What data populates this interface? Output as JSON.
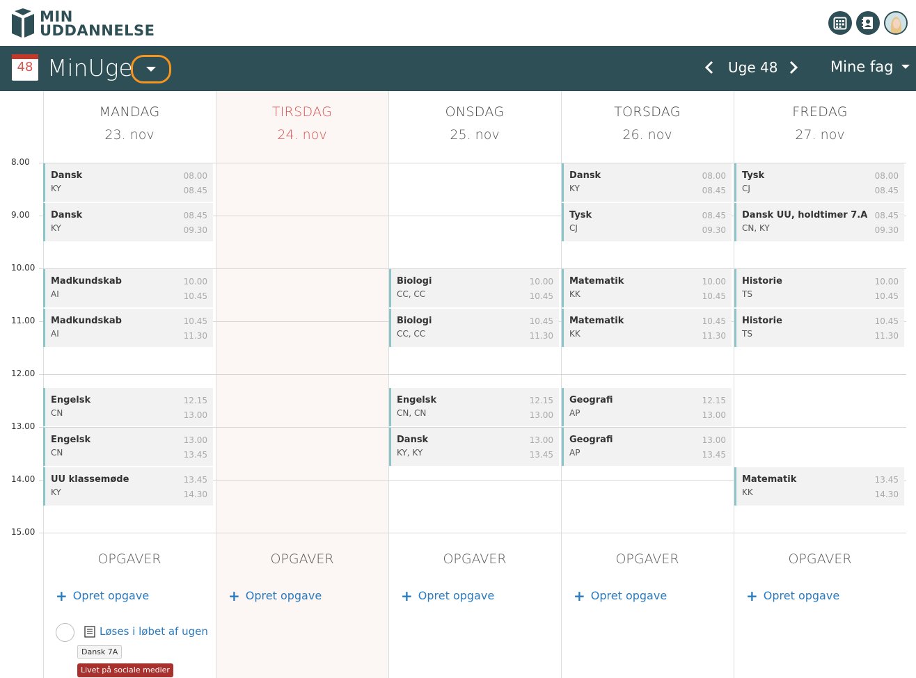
{
  "brand": {
    "line1": "MIN",
    "line2": "UDDANNELSE"
  },
  "header": {
    "calendar_icon_number": "48",
    "title": "MinUge",
    "week_label": "Uge 48",
    "subject_filter": "Mine fag"
  },
  "colors": {
    "header_bg": "#2e4f55",
    "today": "#e05050",
    "link": "#2a7bbf",
    "highlight_ring": "#f5941e",
    "event_border": "#8cc5c9",
    "tag_red": "#a8312e"
  },
  "hours": [
    "8.00",
    "9.00",
    "10.00",
    "11.00",
    "12.00",
    "13.00",
    "14.00",
    "15.00"
  ],
  "days": [
    {
      "name": "MANDAG",
      "date": "23. nov",
      "today": false,
      "tasks_title": "OPGAVER",
      "create_task": "Opret opgave",
      "events": [
        {
          "subject": "Dansk",
          "teacher": "KY",
          "start": "08.00",
          "end": "08.45"
        },
        {
          "subject": "Dansk",
          "teacher": "KY",
          "start": "08.45",
          "end": "09.30"
        },
        {
          "subject": "Madkundskab",
          "teacher": "AI",
          "start": "10.00",
          "end": "10.45"
        },
        {
          "subject": "Madkundskab",
          "teacher": "AI",
          "start": "10.45",
          "end": "11.30"
        },
        {
          "subject": "Engelsk",
          "teacher": "CN",
          "start": "12.15",
          "end": "13.00"
        },
        {
          "subject": "Engelsk",
          "teacher": "CN",
          "start": "13.00",
          "end": "13.45"
        },
        {
          "subject": "UU klassemøde",
          "teacher": "KY",
          "start": "13.45",
          "end": "14.30"
        }
      ],
      "task": {
        "title": "Løses i løbet af ugen",
        "class_tag": "Dansk 7A",
        "topic_tag": "Livet på sociale medier"
      }
    },
    {
      "name": "TIRSDAG",
      "date": "24. nov",
      "today": true,
      "tasks_title": "OPGAVER",
      "create_task": "Opret opgave",
      "events": []
    },
    {
      "name": "ONSDAG",
      "date": "25. nov",
      "today": false,
      "tasks_title": "OPGAVER",
      "create_task": "Opret opgave",
      "events": [
        {
          "subject": "Biologi",
          "teacher": "CC, CC",
          "start": "10.00",
          "end": "10.45"
        },
        {
          "subject": "Biologi",
          "teacher": "CC, CC",
          "start": "10.45",
          "end": "11.30"
        },
        {
          "subject": "Engelsk",
          "teacher": "CN, CN",
          "start": "12.15",
          "end": "13.00"
        },
        {
          "subject": "Dansk",
          "teacher": "KY, KY",
          "start": "13.00",
          "end": "13.45"
        }
      ]
    },
    {
      "name": "TORSDAG",
      "date": "26. nov",
      "today": false,
      "tasks_title": "OPGAVER",
      "create_task": "Opret opgave",
      "events": [
        {
          "subject": "Dansk",
          "teacher": "KY",
          "start": "08.00",
          "end": "08.45"
        },
        {
          "subject": "Tysk",
          "teacher": "CJ",
          "start": "08.45",
          "end": "09.30"
        },
        {
          "subject": "Matematik",
          "teacher": "KK",
          "start": "10.00",
          "end": "10.45"
        },
        {
          "subject": "Matematik",
          "teacher": "KK",
          "start": "10.45",
          "end": "11.30"
        },
        {
          "subject": "Geografi",
          "teacher": "AP",
          "start": "12.15",
          "end": "13.00"
        },
        {
          "subject": "Geografi",
          "teacher": "AP",
          "start": "13.00",
          "end": "13.45"
        }
      ]
    },
    {
      "name": "FREDAG",
      "date": "27. nov",
      "today": false,
      "tasks_title": "OPGAVER",
      "create_task": "Opret opgave",
      "events": [
        {
          "subject": "Tysk",
          "teacher": "CJ",
          "start": "08.00",
          "end": "08.45"
        },
        {
          "subject": "Dansk UU, holdtimer 7.A",
          "teacher": "CN, KY",
          "start": "08.45",
          "end": "09.30"
        },
        {
          "subject": "Historie",
          "teacher": "TS",
          "start": "10.00",
          "end": "10.45"
        },
        {
          "subject": "Historie",
          "teacher": "TS",
          "start": "10.45",
          "end": "11.30"
        },
        {
          "subject": "Matematik",
          "teacher": "KK",
          "start": "13.45",
          "end": "14.30"
        }
      ]
    }
  ]
}
